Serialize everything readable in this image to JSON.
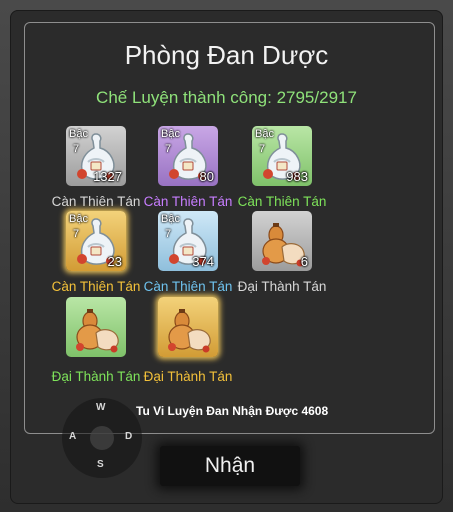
{
  "dialog": {
    "title": "Phòng Đan Dược",
    "subtitle": "Chế Luyện thành công: 2795/2917"
  },
  "items": [
    {
      "tier_label": "Bậc",
      "tier": "7",
      "qty": "1327",
      "name": "Càn Thiên Tán",
      "rarity": "gray",
      "icon": "potion-flask-icon",
      "name_color": "#d7d7d7"
    },
    {
      "tier_label": "Bậc",
      "tier": "7",
      "qty": "80",
      "name": "Càn Thiên Tán",
      "rarity": "purple",
      "icon": "potion-flask-icon",
      "name_color": "#c77dff"
    },
    {
      "tier_label": "Bậc",
      "tier": "7",
      "qty": "983",
      "name": "Càn Thiên Tán",
      "rarity": "green",
      "icon": "potion-flask-icon",
      "name_color": "#7ee35a"
    },
    {
      "tier_label": "Bậc",
      "tier": "7",
      "qty": "23",
      "name": "Càn Thiên Tán",
      "rarity": "gold",
      "icon": "potion-flask-icon",
      "name_color": "#f3c13a"
    },
    {
      "tier_label": "Bậc",
      "tier": "7",
      "qty": "374",
      "name": "Càn Thiên Tán",
      "rarity": "blue",
      "icon": "potion-flask-icon",
      "name_color": "#6fc3ef"
    },
    {
      "tier_label": "",
      "tier": "",
      "qty": "6",
      "name": "Đại Thành Tán",
      "rarity": "gray",
      "icon": "gourd-pill-bag-icon",
      "name_color": "#d7d7d7"
    },
    {
      "tier_label": "",
      "tier": "",
      "qty": "",
      "name": "Đại Thành Tán",
      "rarity": "green",
      "icon": "gourd-pill-bag-icon",
      "name_color": "#7ee35a"
    },
    {
      "tier_label": "",
      "tier": "",
      "qty": "",
      "name": "Đại Thành Tán",
      "rarity": "gold",
      "icon": "gourd-pill-bag-icon",
      "name_color": "#f3c13a"
    }
  ],
  "reward_text": "Tu Vi Luyện Đan Nhận Được 4608",
  "receive_button": "Nhận",
  "joystick": {
    "up": "W",
    "left": "A",
    "right": "D",
    "down": "S"
  }
}
